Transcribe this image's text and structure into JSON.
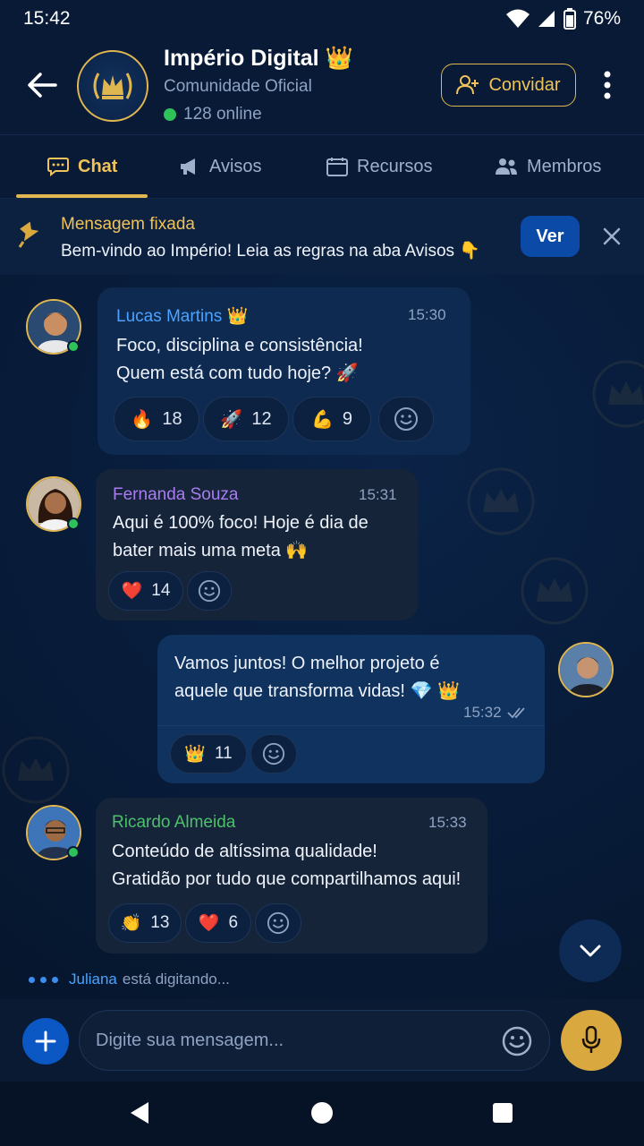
{
  "status_bar": {
    "time": "15:42",
    "battery": "76%"
  },
  "header": {
    "title": "Império Digital",
    "title_emoji": "👑",
    "subtitle": "Comunidade Oficial",
    "online": "128 online",
    "invite_label": "Convidar"
  },
  "tabs": [
    {
      "label": "Chat",
      "icon": "chat-icon",
      "active": true
    },
    {
      "label": "Avisos",
      "icon": "megaphone-icon",
      "active": false
    },
    {
      "label": "Recursos",
      "icon": "calendar-icon",
      "active": false
    },
    {
      "label": "Membros",
      "icon": "people-icon",
      "active": false
    }
  ],
  "pinned": {
    "title": "Mensagem fixada",
    "text": "Bem-vindo ao Império! Leia as regras na aba Avisos 👇",
    "button": "Ver"
  },
  "messages": [
    {
      "sender": "Lucas Martins",
      "sender_emoji": "👑",
      "time": "15:30",
      "text": "Foco, disciplina e consistência!\nQuem está com tudo hoje? 🚀",
      "reactions": [
        {
          "emoji": "🔥",
          "count": "18"
        },
        {
          "emoji": "🚀",
          "count": "12"
        },
        {
          "emoji": "💪",
          "count": "9"
        }
      ]
    },
    {
      "sender": "Fernanda Souza",
      "time": "15:31",
      "text": "Aqui é 100% foco! Hoje é dia de\nbater mais uma meta 🙌",
      "reactions": [
        {
          "emoji": "❤️",
          "count": "14"
        }
      ]
    },
    {
      "own": true,
      "time": "15:32",
      "text": "Vamos juntos! O melhor projeto é\naquele que transforma vidas! 💎 👑",
      "reactions": [
        {
          "emoji": "👑",
          "count": "11"
        }
      ]
    },
    {
      "sender": "Ricardo Almeida",
      "time": "15:33",
      "text": "Conteúdo de altíssima qualidade!\nGratidão por tudo que compartilhamos aqui!",
      "reactions": [
        {
          "emoji": "👏",
          "count": "13"
        },
        {
          "emoji": "❤️",
          "count": "6"
        }
      ]
    }
  ],
  "typing": {
    "name": "Juliana",
    "text": "está digitando..."
  },
  "composer": {
    "placeholder": "Digite sua mensagem..."
  },
  "colors": {
    "accent_gold": "#e0b650",
    "primary_blue": "#0b57c4",
    "online_green": "#2fc25b"
  }
}
